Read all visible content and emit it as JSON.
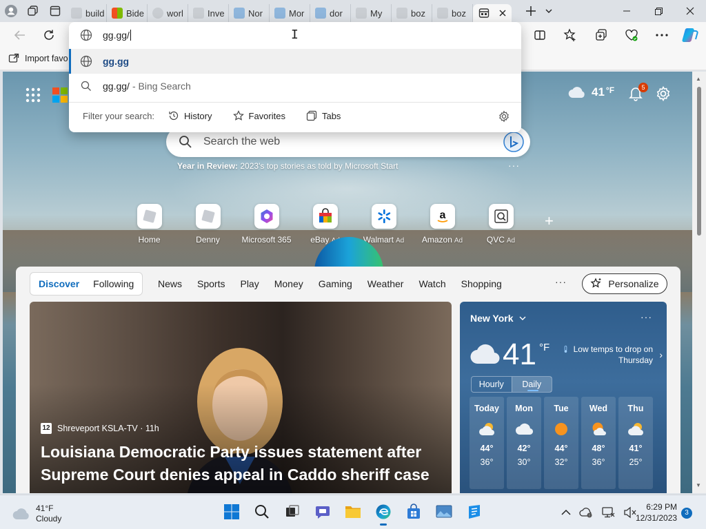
{
  "tabs": [
    {
      "label": "build"
    },
    {
      "label": "Bide"
    },
    {
      "label": "worl"
    },
    {
      "label": "Inve"
    },
    {
      "label": "Nor"
    },
    {
      "label": "Mor"
    },
    {
      "label": "dor"
    },
    {
      "label": "My"
    },
    {
      "label": "boz"
    },
    {
      "label": "boz"
    }
  ],
  "address": {
    "typed": "gg.gg/",
    "suggestions": [
      {
        "text": "gg.gg",
        "kind": "site"
      },
      {
        "text": "gg.gg/",
        "suffix": " - Bing Search",
        "kind": "search"
      }
    ],
    "filter_label": "Filter your search:",
    "filters": [
      "History",
      "Favorites",
      "Tabs"
    ]
  },
  "favbar": {
    "import_label": "Import favo"
  },
  "ntp": {
    "weather_temp": "41",
    "weather_unit": "°F",
    "notifications": "5",
    "search_placeholder": "Search the web",
    "yir_bold": "Year in Review:",
    "yir_text": " 2023's top stories as told by Microsoft Start",
    "quick_links": [
      {
        "label": "Home",
        "ad": ""
      },
      {
        "label": "Denny",
        "ad": ""
      },
      {
        "label": "Microsoft 365",
        "ad": ""
      },
      {
        "label": "eBay",
        "ad": "Ad"
      },
      {
        "label": "Walmart",
        "ad": "Ad"
      },
      {
        "label": "Amazon",
        "ad": "Ad"
      },
      {
        "label": "QVC",
        "ad": "Ad"
      }
    ]
  },
  "feed": {
    "seg": [
      "Discover",
      "Following"
    ],
    "nav": [
      "News",
      "Sports",
      "Play",
      "Money",
      "Gaming",
      "Weather",
      "Watch",
      "Shopping"
    ],
    "more": "···",
    "personalize": "Personalize",
    "hero": {
      "source": "Shreveport KSLA-TV · 11h",
      "headline": "Louisiana Democratic Party issues statement after Supreme Court denies appeal in Caddo sheriff case"
    },
    "weather": {
      "city": "New York",
      "temp": "41",
      "unit": "°F",
      "alert": "Low temps to drop on Thursday",
      "tabs": [
        "Hourly",
        "Daily"
      ],
      "days": [
        {
          "name": "Today",
          "hi": "44°",
          "lo": "36°",
          "icon": "partly-cloudy"
        },
        {
          "name": "Mon",
          "hi": "42°",
          "lo": "30°",
          "icon": "cloudy"
        },
        {
          "name": "Tue",
          "hi": "44°",
          "lo": "32°",
          "icon": "sunny"
        },
        {
          "name": "Wed",
          "hi": "48°",
          "lo": "36°",
          "icon": "partly-sunny"
        },
        {
          "name": "Thu",
          "hi": "41°",
          "lo": "25°",
          "icon": "partly-cloudy"
        }
      ]
    }
  },
  "taskbar": {
    "weather_temp": "41°F",
    "weather_cond": "Cloudy",
    "time": "6:29 PM",
    "date": "12/31/2023",
    "notif_count": "3"
  },
  "colors": {
    "accent": "#0f6cbd",
    "badge": "#d83b01"
  }
}
